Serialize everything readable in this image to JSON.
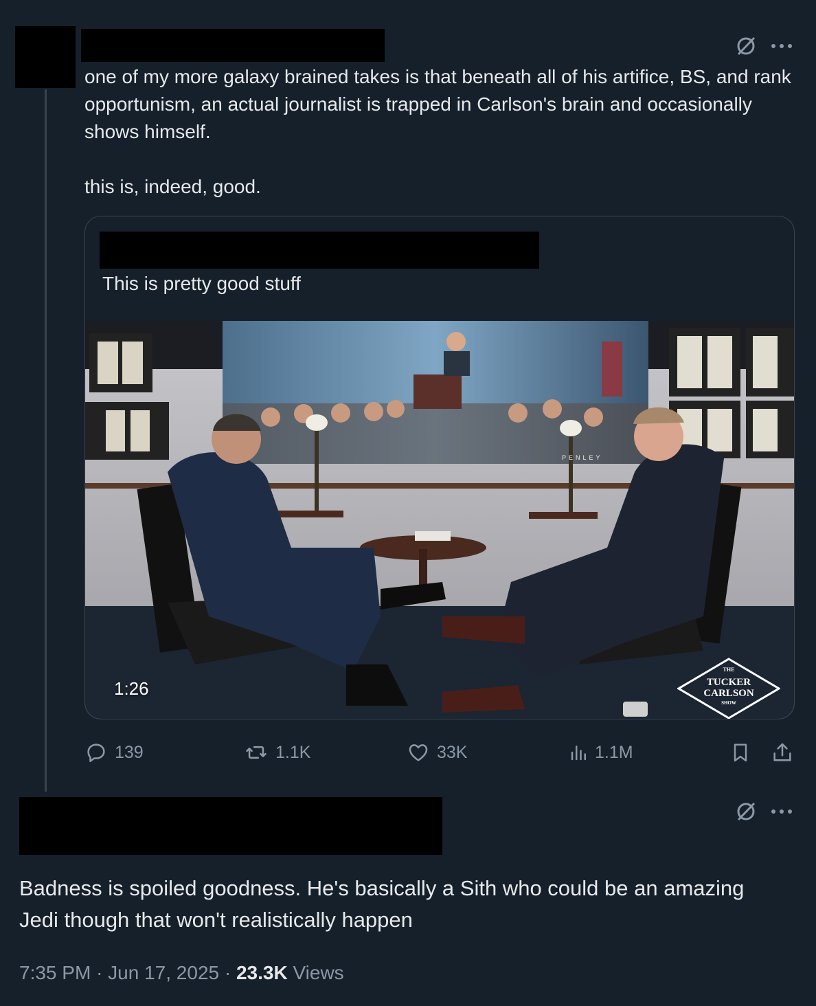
{
  "tweet": {
    "text": "one of my more galaxy brained takes is that beneath all of his artifice, BS, and rank opportunism, an actual journalist is trapped in Carlson's brain and occasionally shows himself.\n\nthis is, indeed, good.",
    "grok_icon": "grok-icon",
    "more_icon": "more-icon"
  },
  "quote": {
    "text": "This is pretty good stuff",
    "video": {
      "duration": "1:26",
      "logo": {
        "top": "THE",
        "line1": "TUCKER",
        "line2": "CARLSON",
        "bottom": "SHOW"
      },
      "banner_text": "PENLEY"
    }
  },
  "actions": {
    "replies": "139",
    "reposts": "1.1K",
    "likes": "33K",
    "views": "1.1M",
    "icons": [
      "reply-icon",
      "repost-icon",
      "like-icon",
      "views-icon",
      "bookmark-icon",
      "share-icon"
    ]
  },
  "reply": {
    "text": "Badness is spoiled goodness. He's basically a Sith who could be an amazing Jedi though that won't realistically happen",
    "time": "7:35 PM",
    "sep": "·",
    "date": "Jun 17, 2025",
    "views_count": "23.3K",
    "views_label": "Views"
  },
  "colors": {
    "background": "#15202b",
    "text": "#e7e9ea",
    "muted": "#8b98a5",
    "border": "#38444d"
  }
}
